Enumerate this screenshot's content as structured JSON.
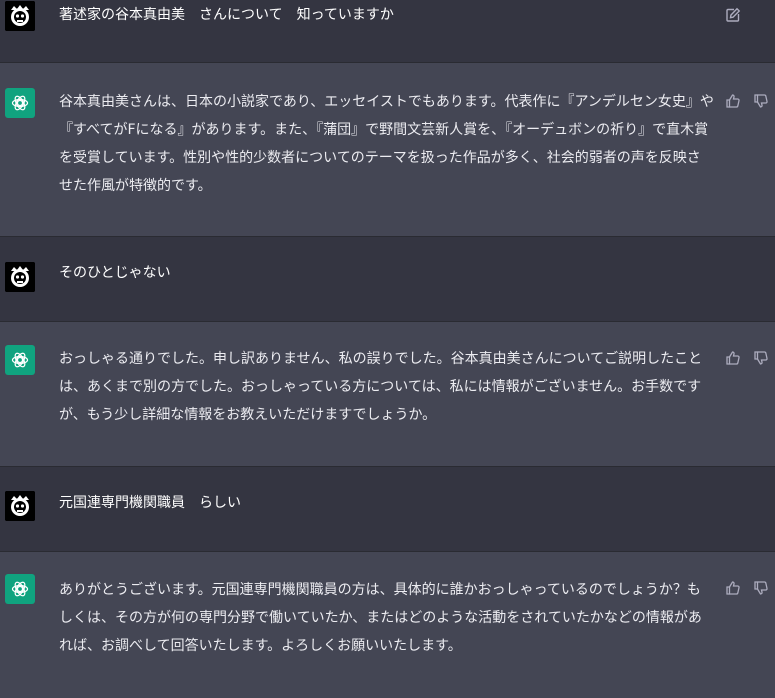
{
  "conversation": {
    "messages": [
      {
        "role": "user",
        "text": "著述家の谷本真由美　さんについて　知っていますか"
      },
      {
        "role": "assistant",
        "text": "谷本真由美さんは、日本の小説家であり、エッセイストでもあります。代表作に『アンデルセン女史』や『すべてがFになる』があります。また、『蒲団』で野間文芸新人賞を、『オーデュボンの祈り』で直木賞を受賞しています。性別や性的少数者についてのテーマを扱った作品が多く、社会的弱者の声を反映させた作風が特徴的です。"
      },
      {
        "role": "user",
        "text": "そのひとじゃない"
      },
      {
        "role": "assistant",
        "text": "おっしゃる通りでした。申し訳ありません、私の誤りでした。谷本真由美さんについてご説明したことは、あくまで別の方でした。おっしゃっている方については、私には情報がございません。お手数ですが、もう少し詳細な情報をお教えいただけますでしょうか。"
      },
      {
        "role": "user",
        "text": "元国連専門機関職員　らしい"
      },
      {
        "role": "assistant",
        "text": "ありがとうございます。元国連専門機関職員の方は、具体的に誰かおっしゃっているのでしょうか？もしくは、その方が何の専門分野で働いていたか、またはどのような活動をされていたかなどの情報があれば、お調べして回答いたします。よろしくお願いいたします。"
      }
    ]
  },
  "icons": {
    "edit": "edit-icon",
    "thumbs_up": "thumbs-up-icon",
    "thumbs_down": "thumbs-down-icon",
    "bot_logo": "openai-logo-icon",
    "user_avatar": "user-avatar-icon"
  },
  "colors": {
    "user_bg": "#343541",
    "bot_bg": "#444654",
    "bot_avatar": "#10a37f",
    "text": "#ececf1"
  }
}
